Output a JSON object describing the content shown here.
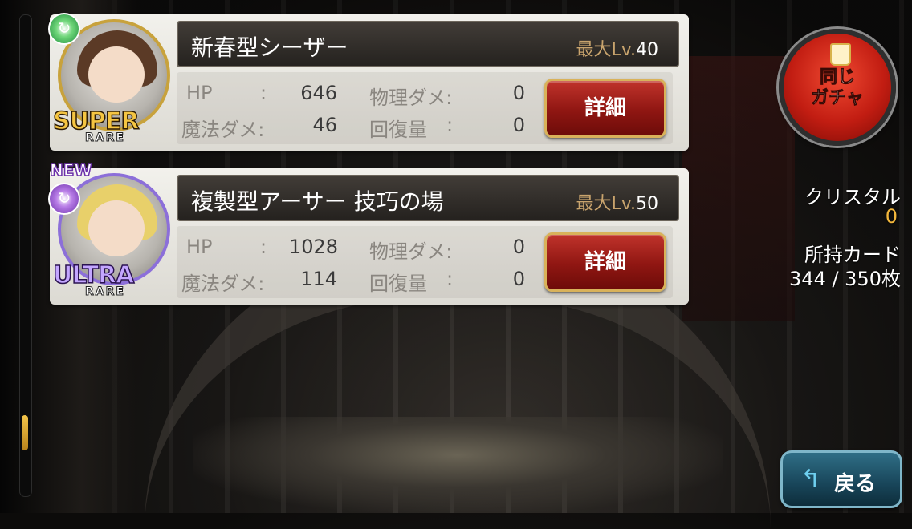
{
  "cards": [
    {
      "name": "新春型シーザー",
      "max_lv_prefix": "最大Lv.",
      "max_lv": "40",
      "rarity_main": "SUPER",
      "rarity_sub": "RARE",
      "new": false,
      "stats": {
        "hp_label": "HP",
        "hp_colon": ":",
        "hp": "646",
        "magic_label": "魔法ダメ:",
        "magic": "46",
        "physical_label": "物理ダメ:",
        "physical": "0",
        "heal_label": "回復量",
        "heal_colon": ":",
        "heal": "0"
      },
      "detail_label": "詳細"
    },
    {
      "name": "複製型アーサー 技巧の場",
      "max_lv_prefix": "最大Lv.",
      "max_lv": "50",
      "rarity_main": "ULTRA",
      "rarity_sub": "RARE",
      "new": true,
      "new_label": "NEW",
      "stats": {
        "hp_label": "HP",
        "hp_colon": ":",
        "hp": "1028",
        "magic_label": "魔法ダメ:",
        "magic": "114",
        "physical_label": "物理ダメ:",
        "physical": "0",
        "heal_label": "回復量",
        "heal_colon": ":",
        "heal": "0"
      },
      "detail_label": "詳細"
    }
  ],
  "sidebar": {
    "gacha_label": "同じ\nガチャ",
    "crystal_label": "クリスタル",
    "crystal_value": "0",
    "cards_owned_label": "所持カード",
    "cards_owned_value": "344 / 350枚"
  },
  "back_label": "戻る",
  "colors": {
    "detail_button": "#8f1612",
    "gacha_button": "#c21d12",
    "back_button": "#184559",
    "crystal_value": "#f2b63c",
    "scroll_thumb": "#f3c54a"
  }
}
